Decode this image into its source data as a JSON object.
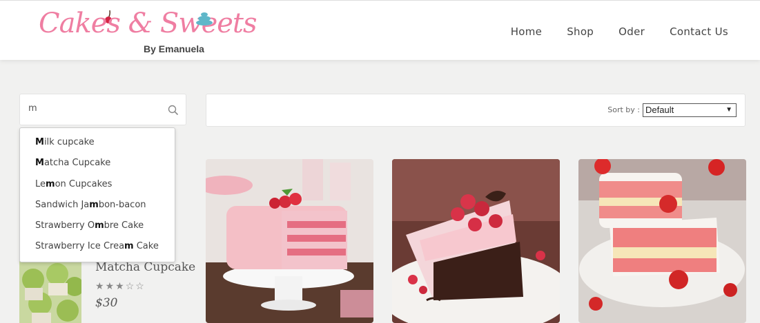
{
  "brand": {
    "logo_text": "Cakes & Sweets",
    "logo_subtitle": "By Emanuela"
  },
  "nav": {
    "items": [
      {
        "label": "Home"
      },
      {
        "label": "Shop"
      },
      {
        "label": "Oder"
      },
      {
        "label": "Contact Us"
      }
    ]
  },
  "search": {
    "value": "m",
    "icon": "search-icon"
  },
  "autocomplete": {
    "suggestions": [
      {
        "pre": "",
        "match": "M",
        "post": "ilk cupcake"
      },
      {
        "pre": "",
        "match": "M",
        "post": "atcha Cupcake"
      },
      {
        "pre": "Le",
        "match": "m",
        "post": "on Cupcakes"
      },
      {
        "pre": "Sandwich Ja",
        "match": "m",
        "post": "bon-bacon"
      },
      {
        "pre": "Strawberry O",
        "match": "m",
        "post": "bre Cake"
      },
      {
        "pre": "Strawberry Ice Crea",
        "match": "m",
        "post": " Cake"
      }
    ]
  },
  "sort": {
    "label": "Sort by :",
    "selected": "Default"
  },
  "featured_product": {
    "name": "Matcha Cupcake",
    "rating": 3,
    "rating_max": 5,
    "price": "$30"
  },
  "colors": {
    "brand_pink": "#ef7ea2",
    "brand_teal": "#5fb7c9"
  }
}
